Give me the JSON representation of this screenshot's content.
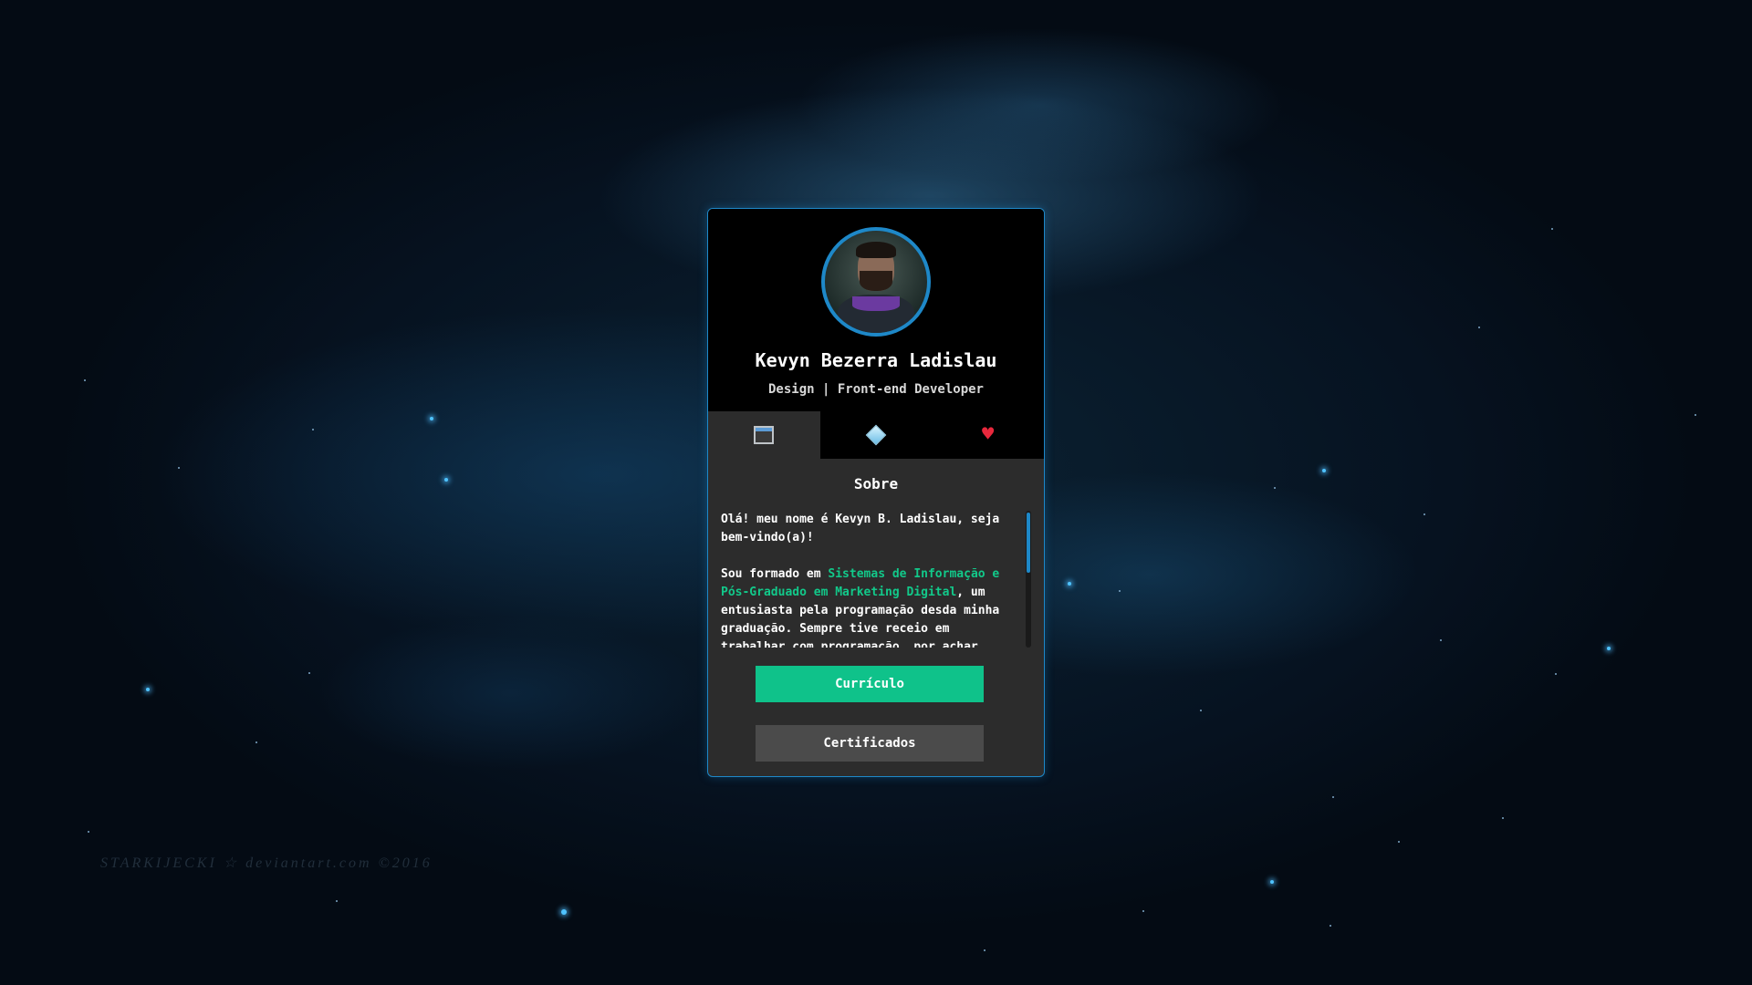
{
  "profile": {
    "name": "Kevyn Bezerra Ladislau",
    "role": "Design | Front-end Developer"
  },
  "tabs": [
    {
      "icon": "window-icon",
      "active": true
    },
    {
      "icon": "diamond-icon",
      "active": false
    },
    {
      "icon": "heart-icon",
      "active": false
    }
  ],
  "about": {
    "title": "Sobre",
    "p1": "Olá! meu nome é Kevyn B. Ladislau, seja bem-vindo(a)!",
    "p2_prefix": "Sou formado em ",
    "p2_highlight": "Sistemas de Informação e Pós-Graduado em Marketing Digital",
    "p2_suffix": ", um entusiasta pela programação desda minha graduação. Sempre tive receio em trabalhar com programação, por achar"
  },
  "buttons": {
    "curriculo": "Currículo",
    "certificados": "Certificados"
  },
  "background": {
    "signature": "STARKIJECKI  ☆ deviantart.com  ©2016"
  },
  "colors": {
    "accent": "#1e88c8",
    "primary_button": "#0fc28a",
    "secondary_button": "#4b4b4b",
    "highlight_text": "#12c98a",
    "card_bg": "#2c2c2c"
  }
}
